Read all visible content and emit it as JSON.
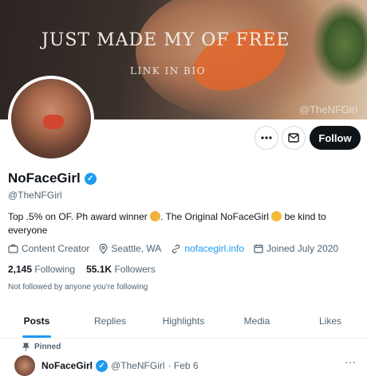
{
  "banner": {
    "headline": "JUST MADE MY OF FREE",
    "subline": "LINK IN BIO",
    "watermark": "@TheNFGirl"
  },
  "profile": {
    "name": "NoFaceGirl",
    "handle": "@TheNFGirl",
    "bio_part1": "Top .5% on OF. Ph award winner ",
    "bio_part2": ". The Original NoFaceGirl ",
    "bio_part3": " be kind to everyone",
    "category": "Content Creator",
    "location": "Seattle, WA",
    "website": "nofacegirl.info",
    "joined": "Joined July 2020",
    "following_count": "2,145",
    "following_label": "Following",
    "followers_count": "55.1K",
    "followers_label": "Followers",
    "not_followed": "Not followed by anyone you're following"
  },
  "actions": {
    "more_icon": "more-icon",
    "message_icon": "mail-icon",
    "follow_label": "Follow"
  },
  "tabs": [
    {
      "label": "Posts"
    },
    {
      "label": "Replies"
    },
    {
      "label": "Highlights"
    },
    {
      "label": "Media"
    },
    {
      "label": "Likes"
    }
  ],
  "pinned_post": {
    "pinned_label": "Pinned",
    "name": "NoFaceGirl",
    "handle": "@TheNFGirl",
    "date": "· Feb 6"
  },
  "colors": {
    "accent": "#1d9bf0",
    "text": "#0f1419",
    "secondary": "#536471"
  }
}
